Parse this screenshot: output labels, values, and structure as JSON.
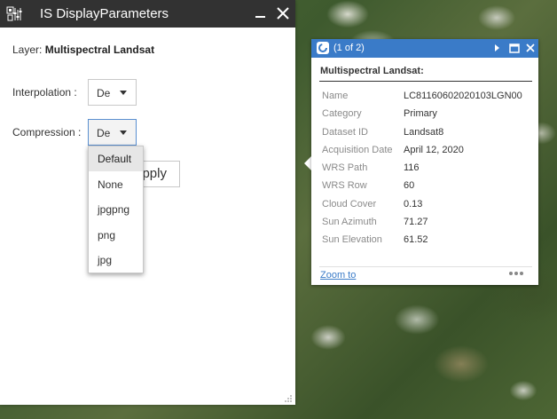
{
  "dialog": {
    "title": "IS DisplayParameters",
    "app_icon": "display-parameters-icon",
    "minimize_icon": "minimize-icon",
    "close_icon": "close-icon",
    "layer_label": "Layer:",
    "layer_value": "Multispectral Landsat",
    "interpolation_label": "Interpolation :",
    "interpolation_value": "De",
    "compression_label": "Compression :",
    "compression_value": "De",
    "apply_text": "pply",
    "compression_options": [
      "Default",
      "None",
      "jpgpng",
      "png",
      "jpg"
    ],
    "compression_selected": "Default"
  },
  "popup": {
    "count_label": "(1 of 2)",
    "title": "Multispectral Landsat:",
    "attributes": [
      {
        "key": "Name",
        "value": "LC81160602020103LGN00"
      },
      {
        "key": "Category",
        "value": "Primary"
      },
      {
        "key": "Dataset ID",
        "value": "Landsat8"
      },
      {
        "key": "Acquisition Date",
        "value": "April 12, 2020"
      },
      {
        "key": "WRS Path",
        "value": "116"
      },
      {
        "key": "WRS Row",
        "value": "60"
      },
      {
        "key": "Cloud Cover",
        "value": "0.13"
      },
      {
        "key": "Sun Azimuth",
        "value": "71.27"
      },
      {
        "key": "Sun Elevation",
        "value": "61.52"
      }
    ],
    "zoom_to_label": "Zoom to",
    "header_color": "#3a7bc8"
  },
  "colors": {
    "titlebar": "#323232",
    "accent": "#3a7bc8"
  }
}
